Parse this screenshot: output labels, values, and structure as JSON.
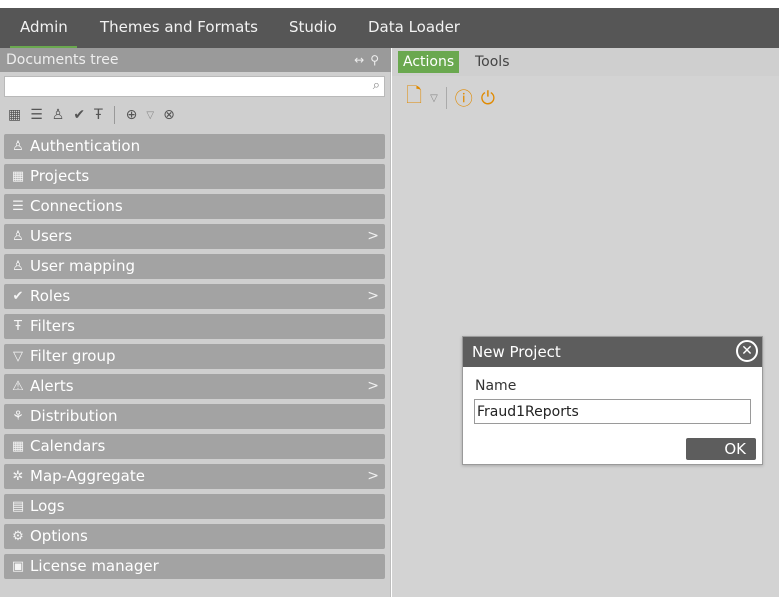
{
  "top_nav": {
    "tabs": [
      {
        "label": "Admin",
        "active": true
      },
      {
        "label": "Themes and Formats",
        "active": false
      },
      {
        "label": "Studio",
        "active": false
      },
      {
        "label": "Data Loader",
        "active": false
      }
    ]
  },
  "left_panel": {
    "title": "Documents tree",
    "header_icons": [
      "resize-horizontal-icon",
      "pin-icon"
    ],
    "search": {
      "value": "",
      "placeholder": ""
    },
    "toolbar_icons": [
      "projects-icon",
      "connections-icon",
      "users-icon",
      "roles-icon",
      "filters-icon",
      "add-icon",
      "dropdown-icon",
      "remove-icon"
    ],
    "items": [
      {
        "label": "Authentication",
        "icon": "authentication-icon",
        "has_arrow": false
      },
      {
        "label": "Projects",
        "icon": "projects-icon",
        "has_arrow": false
      },
      {
        "label": "Connections",
        "icon": "connections-icon",
        "has_arrow": false
      },
      {
        "label": "Users",
        "icon": "users-icon",
        "has_arrow": true
      },
      {
        "label": "User mapping",
        "icon": "user-mapping-icon",
        "has_arrow": false
      },
      {
        "label": "Roles",
        "icon": "roles-icon",
        "has_arrow": true
      },
      {
        "label": "Filters",
        "icon": "filters-icon",
        "has_arrow": false
      },
      {
        "label": "Filter group",
        "icon": "filter-group-icon",
        "has_arrow": false
      },
      {
        "label": "Alerts",
        "icon": "alerts-icon",
        "has_arrow": true
      },
      {
        "label": "Distribution",
        "icon": "distribution-icon",
        "has_arrow": false
      },
      {
        "label": "Calendars",
        "icon": "calendars-icon",
        "has_arrow": false
      },
      {
        "label": "Map-Aggregate",
        "icon": "map-aggregate-icon",
        "has_arrow": true
      },
      {
        "label": "Logs",
        "icon": "logs-icon",
        "has_arrow": false
      },
      {
        "label": "Options",
        "icon": "options-icon",
        "has_arrow": false
      },
      {
        "label": "License manager",
        "icon": "license-manager-icon",
        "has_arrow": false
      }
    ]
  },
  "right_panel": {
    "tabs": [
      {
        "label": "Actions",
        "active": true
      },
      {
        "label": "Tools",
        "active": false
      }
    ],
    "toolbar_icons": [
      "new-document-icon",
      "dropdown-icon",
      "info-icon",
      "power-icon"
    ]
  },
  "dialog": {
    "title": "New Project",
    "name_label": "Name",
    "name_value": "Fraud1Reports",
    "ok_label": "OK"
  },
  "colors": {
    "accent_green": "#6aa84f",
    "topbar": "#565656",
    "tree_item": "#a3a3a3",
    "toolbar_orange": "#e08a00"
  }
}
